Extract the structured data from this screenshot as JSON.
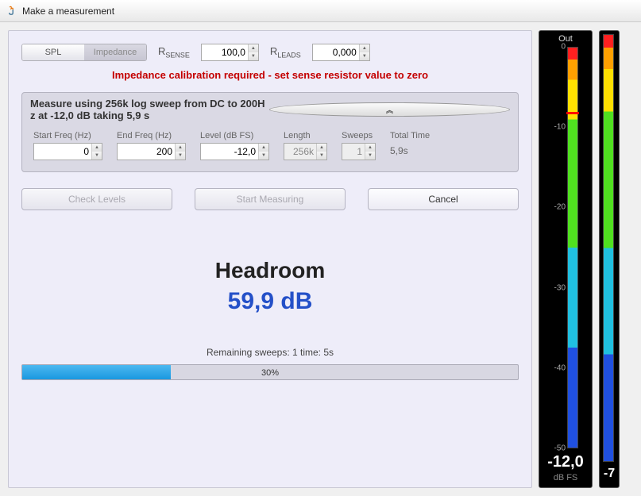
{
  "window": {
    "title": "Make a measurement"
  },
  "toggle": {
    "spl": "SPL",
    "impedance": "Impedance"
  },
  "resistors": {
    "sense_label_base": "R",
    "sense_label_sub": "SENSE",
    "sense_value": "100,0",
    "leads_label_base": "R",
    "leads_label_sub": "LEADS",
    "leads_value": "0,000"
  },
  "warning": "Impedance calibration required - set sense resistor value to zero",
  "params": {
    "summary": "Measure using  256k log sweep from DC to 200H z at -12,0 dB taking 5,9 s",
    "start_freq_label": "Start Freq (Hz)",
    "start_freq": "0",
    "end_freq_label": "End Freq (Hz)",
    "end_freq": "200",
    "level_label": "Level (dB FS)",
    "level": "-12,0",
    "length_label": "Length",
    "length": "256k",
    "sweeps_label": "Sweeps",
    "sweeps": "1",
    "total_time_label": "Total Time",
    "total_time": "5,9s"
  },
  "buttons": {
    "check_levels": "Check Levels",
    "start": "Start Measuring",
    "cancel": "Cancel"
  },
  "headroom": {
    "title": "Headroom",
    "value": "59,9 dB"
  },
  "status": {
    "text": "Remaining sweeps: 1   time: 5s",
    "progress_pct": "30%",
    "progress_width": "30%"
  },
  "meter": {
    "out_label": "Out",
    "ticks": [
      "0",
      "-10",
      "-20",
      "-30",
      "-40",
      "-50"
    ],
    "readout": "-12,0",
    "readout2": "-7",
    "unit": "dB FS",
    "mark_pct": "16%"
  },
  "chart_data": {
    "type": "bar",
    "title": "Out",
    "ylabel": "dB FS",
    "ylim": [
      -50,
      0
    ],
    "categories": [
      "Out"
    ],
    "values": [
      -12.0
    ]
  }
}
